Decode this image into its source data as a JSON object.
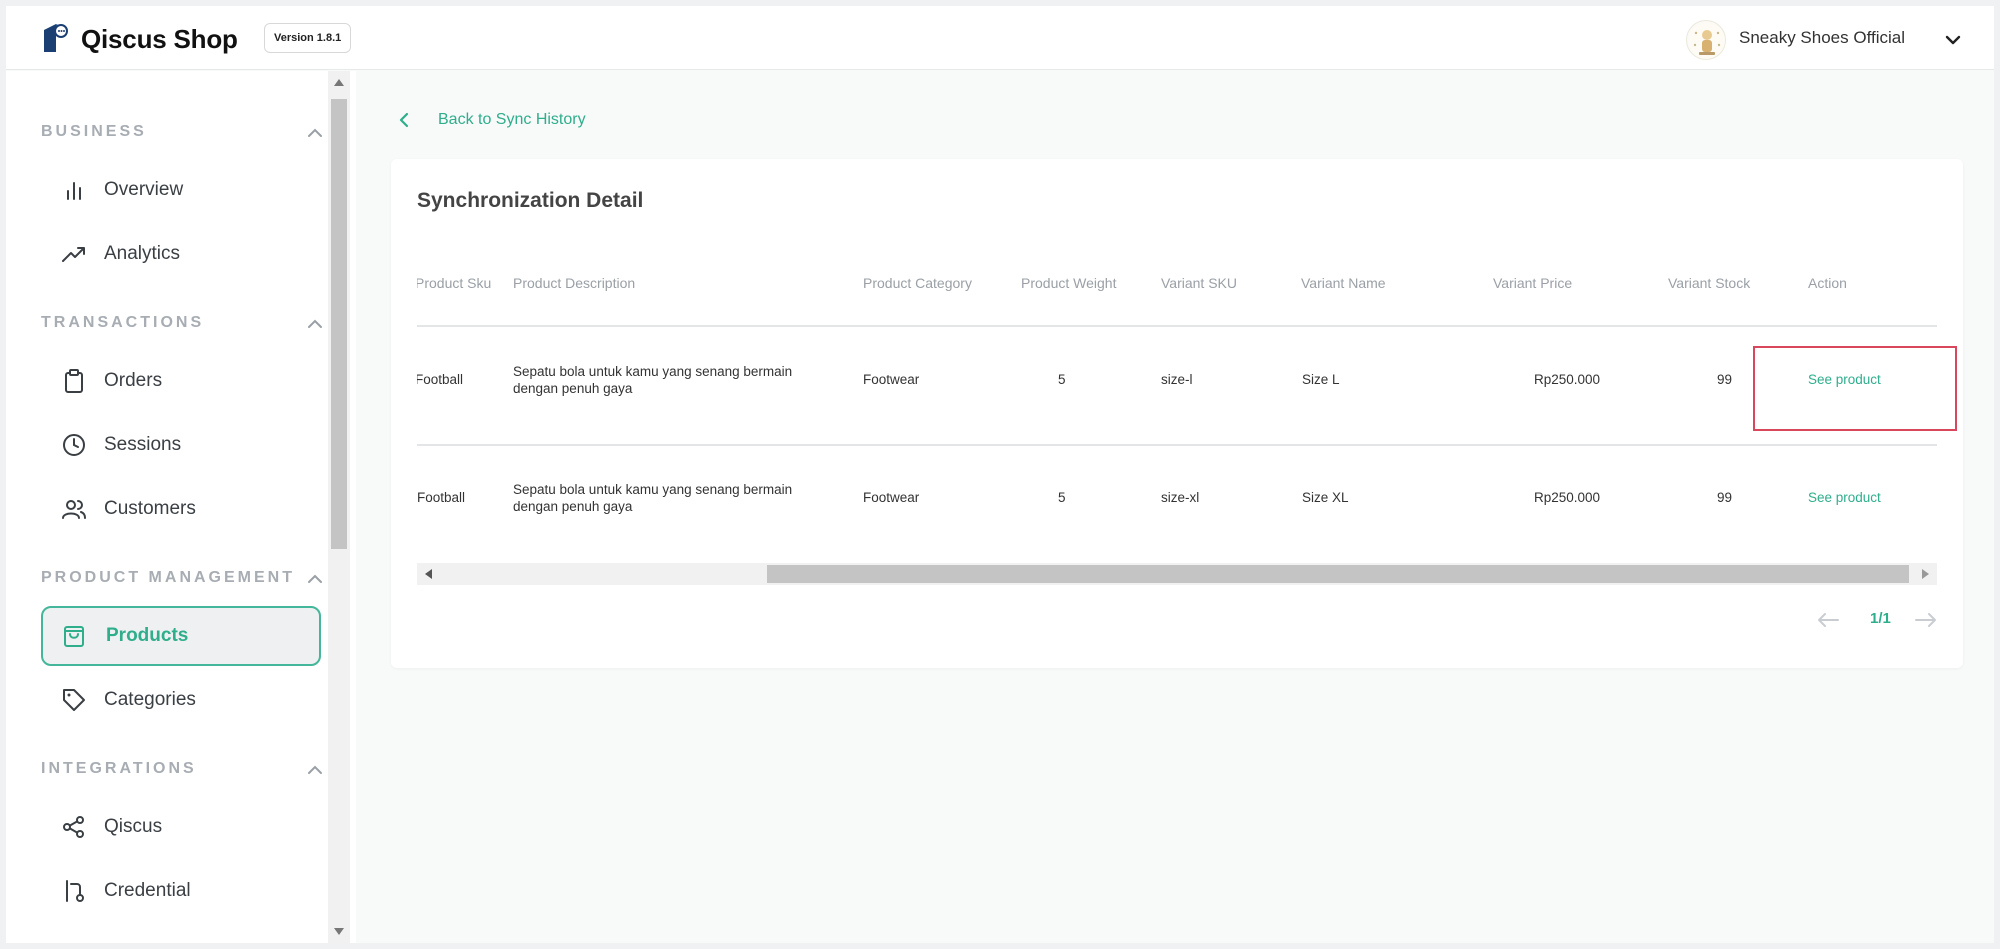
{
  "header": {
    "app_title": "Qiscus Shop",
    "version": "Version 1.8.1",
    "store_name": "Sneaky Shoes Official",
    "icons": {
      "logo": "qiscus-logo-icon",
      "chevron": "chevron-down-icon"
    }
  },
  "sidebar": {
    "sections": [
      {
        "title": "BUSINESS",
        "items": [
          {
            "label": "Overview",
            "icon": "bar-chart-icon"
          },
          {
            "label": "Analytics",
            "icon": "trending-up-icon"
          }
        ]
      },
      {
        "title": "TRANSACTIONS",
        "items": [
          {
            "label": "Orders",
            "icon": "clipboard-icon"
          },
          {
            "label": "Sessions",
            "icon": "clock-icon"
          },
          {
            "label": "Customers",
            "icon": "users-icon"
          }
        ]
      },
      {
        "title": "PRODUCT MANAGEMENT",
        "items": [
          {
            "label": "Products",
            "icon": "shopping-bag-icon",
            "active": true
          },
          {
            "label": "Categories",
            "icon": "tag-icon"
          }
        ]
      },
      {
        "title": "INTEGRATIONS",
        "items": [
          {
            "label": "Qiscus",
            "icon": "share-icon"
          },
          {
            "label": "Credential",
            "icon": "git-pull-request-icon"
          }
        ]
      }
    ]
  },
  "main": {
    "back_label": "Back to Sync History",
    "card_title": "Synchronization Detail",
    "table": {
      "columns": [
        "Product Sku",
        "Product Description",
        "Product Category",
        "Product Weight",
        "Variant SKU",
        "Variant Name",
        "Variant Price",
        "Variant Stock",
        "Action"
      ],
      "rows": [
        {
          "sku": "Football",
          "description": "Sepatu bola untuk kamu yang senang bermain dengan penuh gaya",
          "category": "Footwear",
          "weight": "5",
          "variant_sku": "size-l",
          "variant_name": "Size L",
          "price": "Rp250.000",
          "stock": "99",
          "action": "See product"
        },
        {
          "sku": "Football",
          "description": "Sepatu bola untuk kamu yang senang bermain dengan penuh gaya",
          "category": "Footwear",
          "weight": "5",
          "variant_sku": "size-xl",
          "variant_name": "Size XL",
          "price": "Rp250.000",
          "stock": "99",
          "action": "See product"
        }
      ]
    },
    "pagination": {
      "label": "1/1"
    }
  },
  "colors": {
    "accent": "#2fae8c",
    "highlight": "#d8475b"
  }
}
